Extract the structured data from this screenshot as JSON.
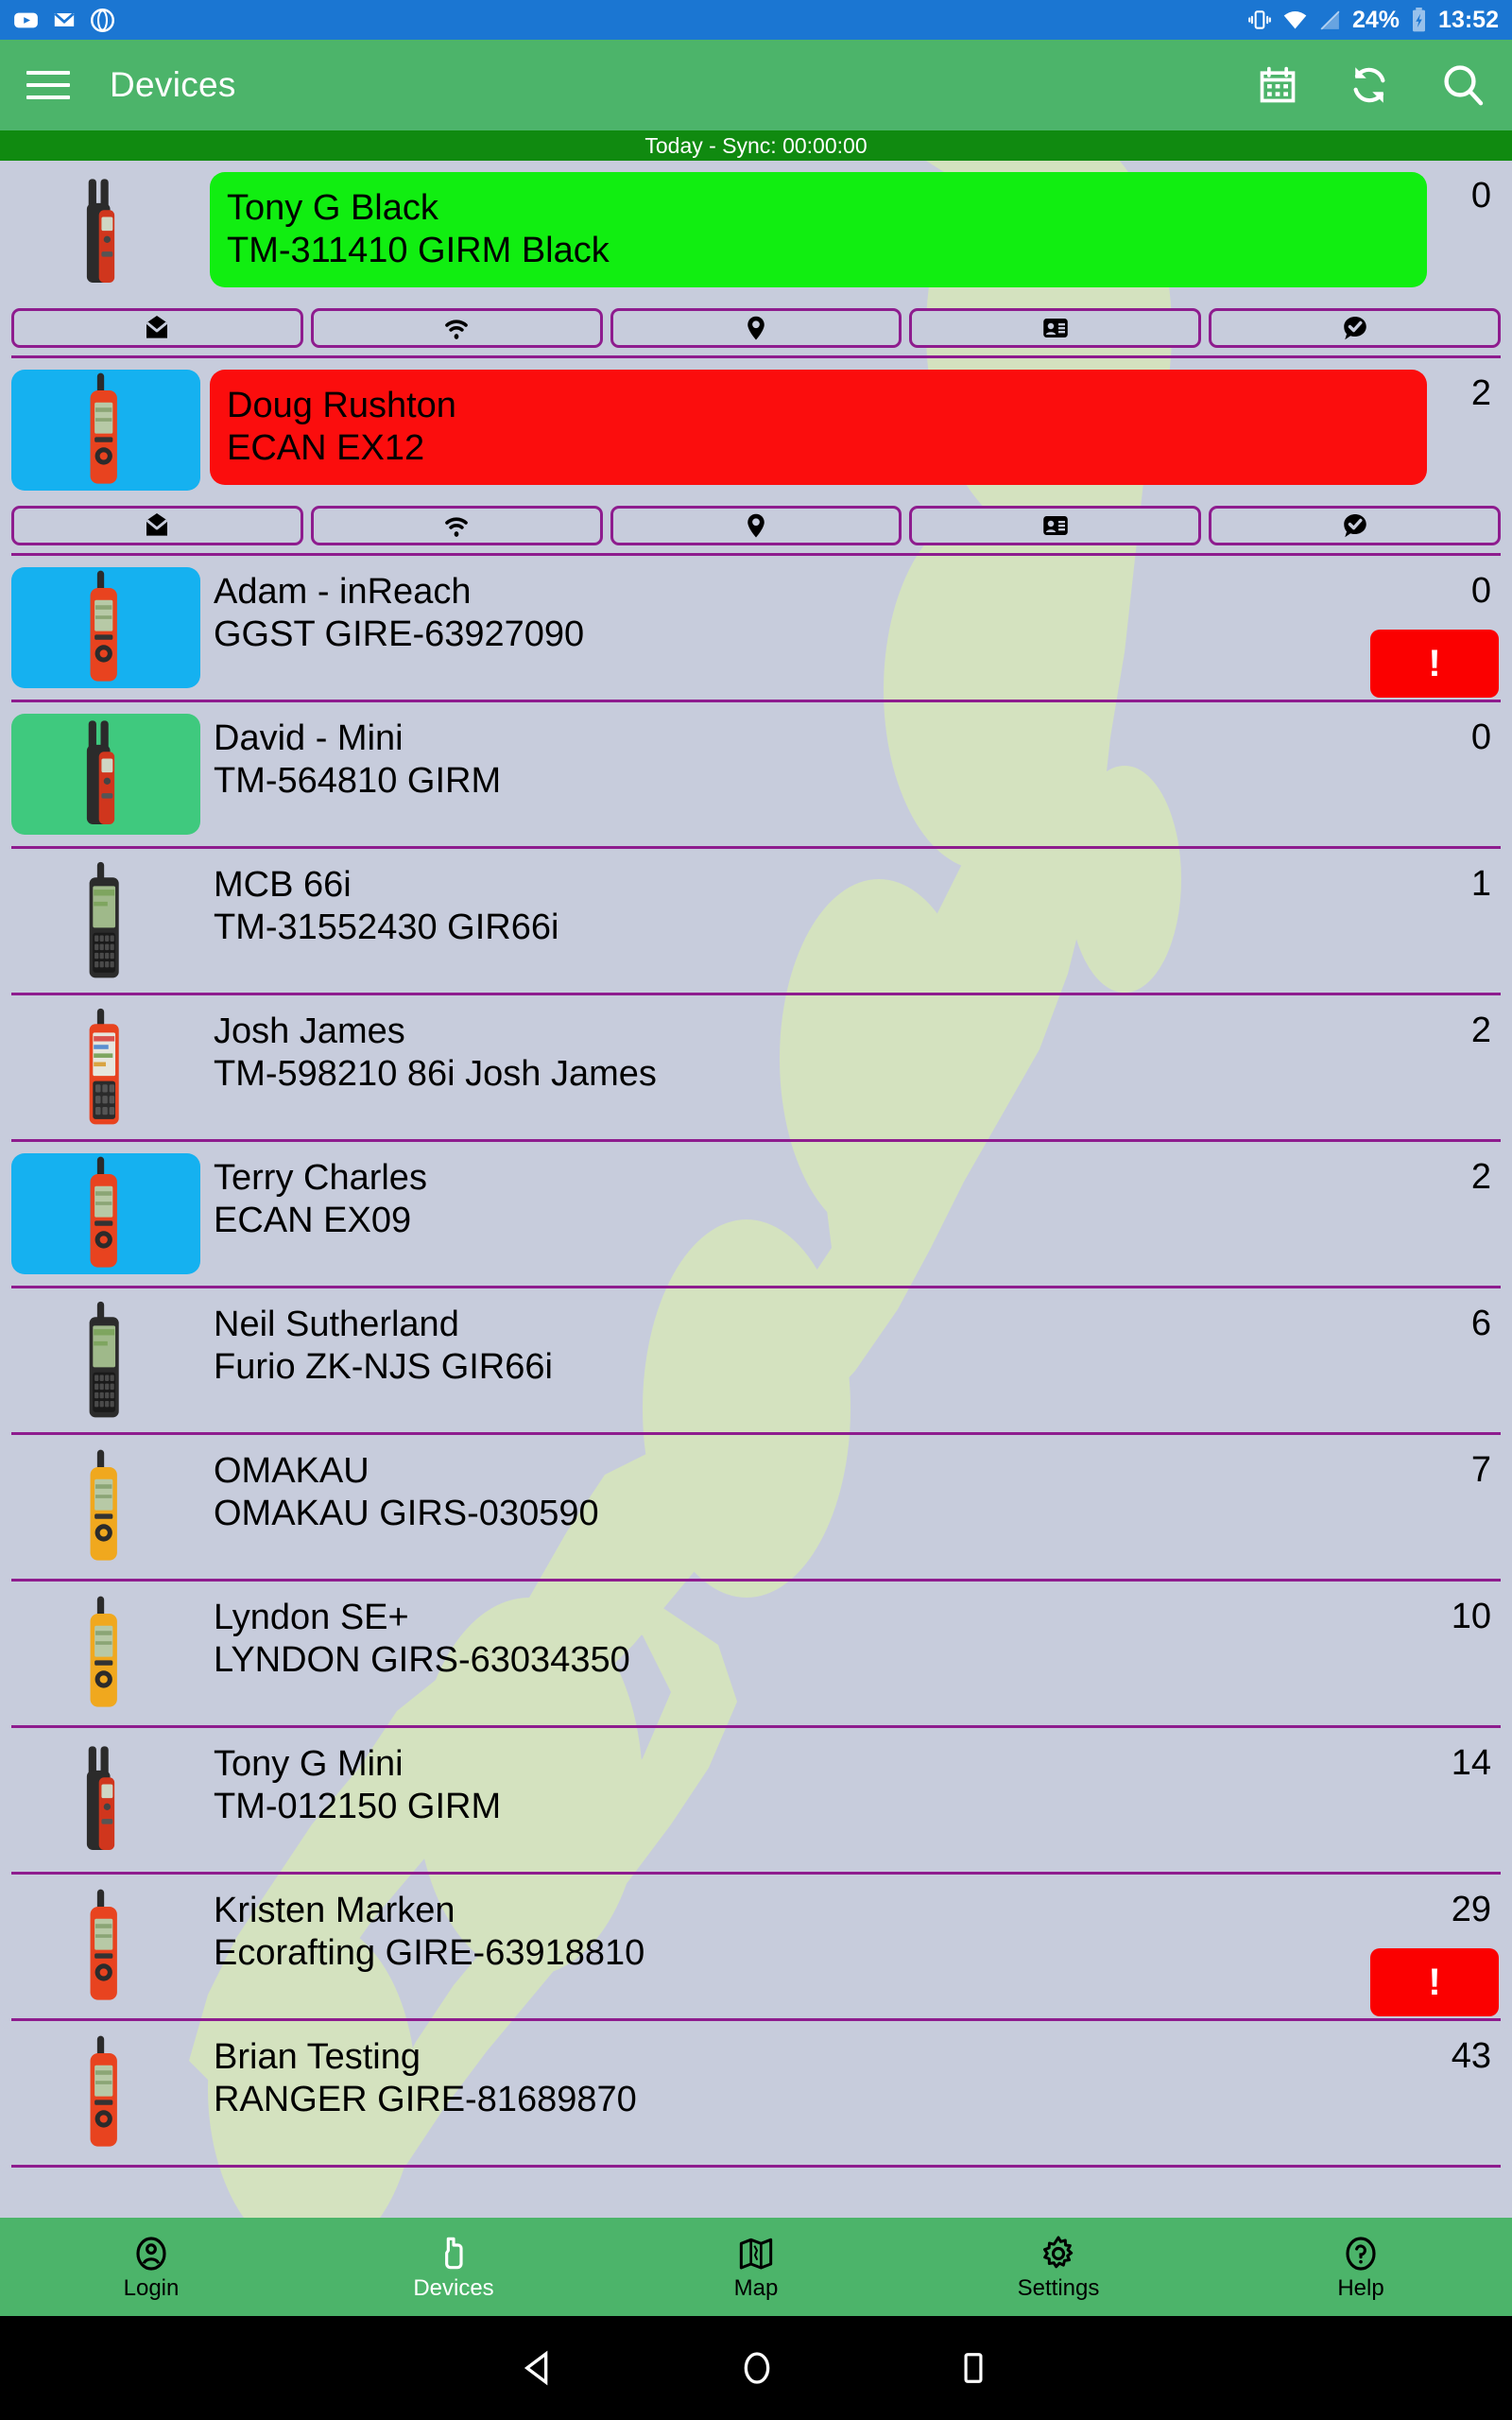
{
  "status_bar": {
    "left_icons": [
      "youtube-icon",
      "gmail-icon",
      "circle-app-icon"
    ],
    "right_icons": [
      "vibrate-icon",
      "wifi-icon",
      "signal-off-icon",
      "battery-charging-icon"
    ],
    "battery": "24%",
    "time": "13:52",
    "background": "#1b76d2"
  },
  "app_bar": {
    "menu_icon": "hamburger-icon",
    "title": "Devices",
    "actions": [
      "calendar-icon",
      "sync-refresh-icon",
      "search-icon"
    ],
    "background": "#4cb46a"
  },
  "sync_bar": {
    "text": "Today - Sync: 00:00:00",
    "background": "#108a10"
  },
  "action_buttons": {
    "labels": [
      "message-icon",
      "wifi-icon",
      "location-pin-icon",
      "contact-card-icon",
      "checkin-icon"
    ],
    "border_color": "#8e1c8e"
  },
  "devices": [
    {
      "name": "Tony G Black",
      "sub": "TM-311410 GIRM Black",
      "count": "0",
      "banner": "green",
      "icon_highlight": "none",
      "device_type": "inreach-mini",
      "alert": false,
      "expanded": true
    },
    {
      "name": "Doug Rushton",
      "sub": "ECAN EX12",
      "count": "2",
      "banner": "red",
      "icon_highlight": "blue",
      "device_type": "inreach-explorer",
      "alert": false,
      "expanded": true
    },
    {
      "name": "Adam - inReach",
      "sub": "GGST GIRE-63927090",
      "count": "0",
      "banner": "none",
      "icon_highlight": "blue",
      "device_type": "inreach-explorer",
      "alert": true,
      "expanded": false
    },
    {
      "name": "David - Mini",
      "sub": "TM-564810 GIRM",
      "count": "0",
      "banner": "none",
      "icon_highlight": "green",
      "device_type": "inreach-mini",
      "alert": false,
      "expanded": false
    },
    {
      "name": "MCB 66i",
      "sub": "TM-31552430 GIR66i",
      "count": "1",
      "banner": "none",
      "icon_highlight": "none",
      "device_type": "gpsmap-66i",
      "alert": false,
      "expanded": false
    },
    {
      "name": "Josh James",
      "sub": "TM-598210 86i Josh James",
      "count": "2",
      "banner": "none",
      "icon_highlight": "none",
      "device_type": "gpsmap-86i",
      "alert": false,
      "expanded": false
    },
    {
      "name": "Terry Charles",
      "sub": "ECAN EX09",
      "count": "2",
      "banner": "none",
      "icon_highlight": "blue",
      "device_type": "inreach-explorer",
      "alert": false,
      "expanded": false
    },
    {
      "name": "Neil Sutherland",
      "sub": "Furio ZK-NJS GIR66i",
      "count": "6",
      "banner": "none",
      "icon_highlight": "none",
      "device_type": "gpsmap-66i",
      "alert": false,
      "expanded": false
    },
    {
      "name": "OMAKAU",
      "sub": "OMAKAU GIRS-030590",
      "count": "7",
      "banner": "none",
      "icon_highlight": "none",
      "device_type": "inreach-se",
      "alert": false,
      "expanded": false
    },
    {
      "name": "Lyndon SE+",
      "sub": "LYNDON GIRS-63034350",
      "count": "10",
      "banner": "none",
      "icon_highlight": "none",
      "device_type": "inreach-se",
      "alert": false,
      "expanded": false
    },
    {
      "name": "Tony G Mini",
      "sub": "TM-012150 GIRM",
      "count": "14",
      "banner": "none",
      "icon_highlight": "none",
      "device_type": "inreach-mini",
      "alert": false,
      "expanded": false
    },
    {
      "name": "Kristen Marken",
      "sub": "Ecorafting GIRE-63918810",
      "count": "29",
      "banner": "none",
      "icon_highlight": "none",
      "device_type": "inreach-explorer",
      "alert": true,
      "expanded": false
    },
    {
      "name": "Brian Testing",
      "sub": "RANGER GIRE-81689870",
      "count": "43",
      "banner": "none",
      "icon_highlight": "none",
      "device_type": "inreach-explorer",
      "alert": false,
      "expanded": false
    }
  ],
  "bottom_nav": {
    "items": [
      {
        "label": "Login",
        "icon": "account-circle-icon",
        "active": false
      },
      {
        "label": "Devices",
        "icon": "device-icon",
        "active": true
      },
      {
        "label": "Map",
        "icon": "map-icon",
        "active": false
      },
      {
        "label": "Settings",
        "icon": "gear-icon",
        "active": false
      },
      {
        "label": "Help",
        "icon": "help-circle-icon",
        "active": false
      }
    ],
    "background": "#4cb46a"
  },
  "android_nav": {
    "icons": [
      "back-triangle-icon",
      "home-circle-icon",
      "recents-square-icon"
    ]
  },
  "alert_label": "!",
  "colors": {
    "list_background": "#c7ccdc",
    "map_watermark": "#ddf0ae",
    "separator": "#8e1c8e",
    "banner_green": "#11ee11",
    "banner_red": "#fb0d0d",
    "highlight_blue": "#15b1f0",
    "highlight_green": "#3fc97e",
    "alert_red": "#fb0000"
  }
}
